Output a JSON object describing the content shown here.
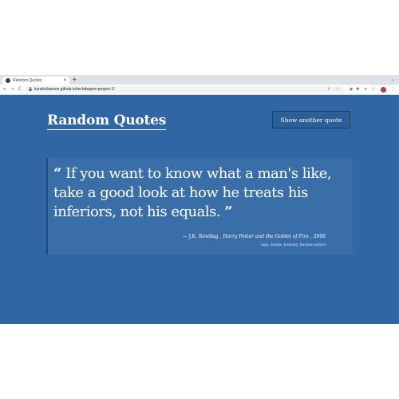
{
  "browser": {
    "tab_title": "Random Quotes",
    "tab_close": "×",
    "new_tab": "+",
    "tab_menu": "⌄",
    "url": "kyrakinlawson.github.io/techdegree-project-1/",
    "nav": {
      "back": "←",
      "forward": "→",
      "reload": "C"
    },
    "menu": "⋮"
  },
  "page": {
    "title": "Random Quotes",
    "button_label": "Show another quote",
    "quote": {
      "open_mark": "“",
      "close_mark": "”",
      "text": "If you want to know what a man's like, take a good look at how he treats his inferiors, not his equals.",
      "dash": "— ",
      "source": "J.K. Rowling",
      "citation": "Harry Potter and the Goblet of Fire",
      "year": "2000",
      "tags": "tags: books, honesty, human-nature"
    }
  },
  "colors": {
    "background": "#2f66a3",
    "card": "#3a6ea8",
    "card_border": "#214a78",
    "button_border": "#1c3d63"
  }
}
